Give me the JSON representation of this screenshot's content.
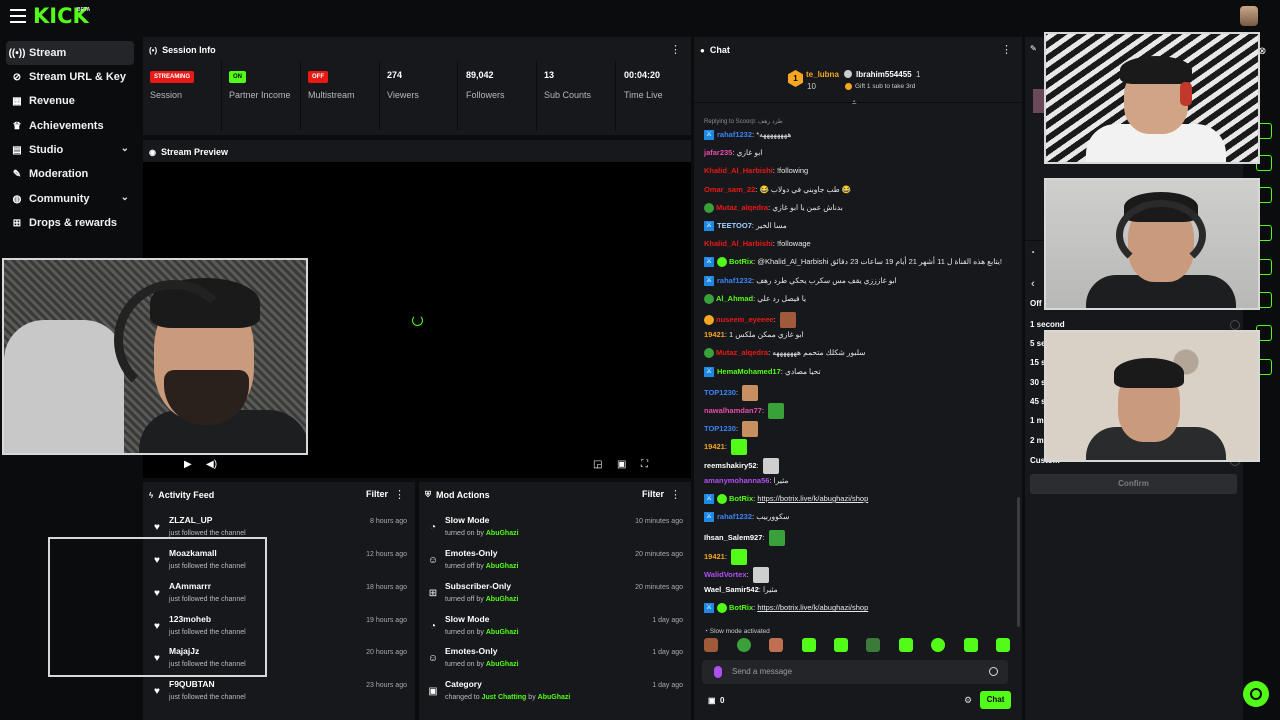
{
  "brand": {
    "logo": "KICK",
    "beta": "BETA"
  },
  "sidebar": {
    "items": [
      {
        "label": "Stream",
        "icon": "broadcast-icon",
        "active": true
      },
      {
        "label": "Stream URL & Key",
        "icon": "link-icon"
      },
      {
        "label": "Revenue",
        "icon": "revenue-icon"
      },
      {
        "label": "Achievements",
        "icon": "trophy-icon"
      },
      {
        "label": "Studio",
        "icon": "studio-icon",
        "expandable": true
      },
      {
        "label": "Moderation",
        "icon": "wrench-icon"
      },
      {
        "label": "Community",
        "icon": "community-icon",
        "expandable": true
      },
      {
        "label": "Drops & rewards",
        "icon": "gift-icon"
      }
    ]
  },
  "session": {
    "title": "Session Info",
    "stats": [
      {
        "value": "STREAMING",
        "label": "Session",
        "kind": "badge",
        "color": "#e91916"
      },
      {
        "value": "ON",
        "label": "Partner Income",
        "kind": "badge",
        "color": "#53fc18"
      },
      {
        "value": "OFF",
        "label": "Multistream",
        "kind": "badge",
        "color": "#e91916"
      },
      {
        "value": "274",
        "label": "Viewers"
      },
      {
        "value": "89,042",
        "label": "Followers"
      },
      {
        "value": "13",
        "label": "Sub Counts"
      },
      {
        "value": "00:04:20",
        "label": "Time Live"
      }
    ]
  },
  "preview": {
    "title": "Stream Preview"
  },
  "activity": {
    "title": "Activity Feed",
    "filter": "Filter",
    "rows": [
      {
        "name": "ZLZAL_UP",
        "sub": "just followed the channel",
        "time": "8 hours ago"
      },
      {
        "name": "Moazkamall",
        "sub": "just followed the channel",
        "time": "12 hours ago"
      },
      {
        "name": "AAmmarrr",
        "sub": "just followed the channel",
        "time": "18 hours ago"
      },
      {
        "name": "123moheb",
        "sub": "just followed the channel",
        "time": "19 hours ago"
      },
      {
        "name": "MajajJz",
        "sub": "just followed the channel",
        "time": "20 hours ago"
      },
      {
        "name": "F9QUBTAN",
        "sub": "just followed the channel",
        "time": "23 hours ago"
      }
    ]
  },
  "mod_actions": {
    "title": "Mod Actions",
    "filter": "Filter",
    "rows": [
      {
        "name": "Slow Mode",
        "action": "turned on by",
        "by": "AbuGhazi",
        "time": "10 minutes ago",
        "icon": "slow-mode-icon"
      },
      {
        "name": "Emotes-Only",
        "action": "turned off by",
        "by": "AbuGhazi",
        "time": "20 minutes ago",
        "icon": "emote-icon"
      },
      {
        "name": "Subscriber-Only",
        "action": "turned off by",
        "by": "AbuGhazi",
        "time": "20 minutes ago",
        "icon": "gift-icon"
      },
      {
        "name": "Slow Mode",
        "action": "turned on by",
        "by": "AbuGhazi",
        "time": "1 day ago",
        "icon": "slow-mode-icon"
      },
      {
        "name": "Emotes-Only",
        "action": "turned on by",
        "by": "AbuGhazi",
        "time": "1 day ago",
        "icon": "emote-icon"
      },
      {
        "name": "Category",
        "action": "changed to",
        "category": "Just Chatting",
        "by_prefix": "by",
        "by": "AbuGhazi",
        "time": "1 day ago",
        "icon": "category-icon"
      }
    ]
  },
  "chat": {
    "title": "Chat",
    "pinned": {
      "user1": "te_lubna",
      "user1_count": "10",
      "user1_rank": "1",
      "user2": "Ibrahim554455",
      "user2_count": "1",
      "gift_text": "Gift 1 sub to take 3rd"
    },
    "reply_to": "Replying to Scoorp: طرد رهف",
    "messages": [
      {
        "user": "rahaf1232",
        "text": "*ههههههههه",
        "color": "#3b82f6",
        "mod": true
      },
      {
        "user": "jafar235",
        "text": "ابو غازي",
        "color": "#e94cab"
      },
      {
        "user": "Khalid_Al_Harbishi",
        "text": "!following",
        "color": "#e91916"
      },
      {
        "user": "Omar_sam_22",
        "text": "😂 طب جاوبني في دولاب 😂",
        "color": "#e91916"
      },
      {
        "user": "Mutaz_alqedra",
        "text": "بدناش عمن يا ابو غازي",
        "color": "#e91916",
        "badge": "green"
      },
      {
        "user": "TEETOO7",
        "text": "مسا الخير",
        "color": "#9ad0ff",
        "mod": true
      },
      {
        "user": "Khalid_Al_Harbishi",
        "text": "!followage",
        "color": "#e91916"
      },
      {
        "user": "BotRix",
        "text": "@Khalid_Al_Harbishi يتابع هذه القناة ل 11 أشهر 21 أيام 19 ساعات 23 دقائق!",
        "color": "#53fc18",
        "mod": true,
        "verified": true
      },
      {
        "user": "rahaf1232",
        "text": "ابو غازززي يقف مس سكرب يحكي طرد رهف",
        "color": "#3b82f6",
        "mod": true
      },
      {
        "user": "Al_Ahmad",
        "text": "يا فيصل رد علي",
        "color": "#53fc18",
        "badge": "green"
      },
      {
        "user": "nuseem_eyeeee",
        "text": "",
        "color": "#e91916",
        "emote": "#a05a3a",
        "badge": "gold"
      },
      {
        "user": "19421",
        "text": "ابو غازي ممكن ملكس 1",
        "color": "#f5a623"
      },
      {
        "user": "Mutaz_alqedra",
        "text": "سلبور شكلك متحمم هههههههه",
        "color": "#e91916",
        "badge": "green"
      },
      {
        "user": "HemaMohamed17",
        "text": "تحيا مصادي",
        "color": "#53fc18",
        "mod": true
      },
      {
        "user": "TOP1230",
        "text": "",
        "color": "#3b82f6",
        "emote": "#c89060"
      },
      {
        "user": "nawalhamdan77",
        "text": "",
        "color": "#e94cab",
        "emote": "#3aa03a"
      },
      {
        "user": "TOP1230",
        "text": "",
        "color": "#3b82f6",
        "emote": "#c89060"
      },
      {
        "user": "19421",
        "text": "",
        "color": "#f5a623",
        "emote": "#53fc18"
      },
      {
        "user": "reemshakiry52",
        "text": "",
        "color": "#ffffff",
        "emote": "#cfcfcf"
      },
      {
        "user": "amanymohanna56",
        "text": "مثيرا",
        "color": "#b04ef0"
      },
      {
        "user": "BotRix",
        "text": "https://botrix.live/k/abughazi/shop",
        "color": "#53fc18",
        "mod": true,
        "verified": true,
        "link": true
      },
      {
        "user": "rahaf1232",
        "text": "سكووربيب",
        "color": "#3b82f6",
        "mod": true
      },
      {
        "user": "Ihsan_Salem927",
        "text": "",
        "color": "#ffffff",
        "emote": "#3aa03a"
      },
      {
        "user": "19421",
        "text": "",
        "color": "#f5a623",
        "emote": "#53fc18"
      },
      {
        "user": "WalidVortex",
        "text": "",
        "color": "#b04ef0",
        "emote": "#cfcfcf"
      },
      {
        "user": "Wael_Samir542",
        "text": "مثيرا",
        "color": "#ffffff"
      },
      {
        "user": "BotRix",
        "text": "https://botrix.live/k/abughazi/shop",
        "color": "#53fc18",
        "mod": true,
        "verified": true,
        "link": true
      }
    ],
    "slow_mode": "Slow mode activated",
    "input_placeholder": "Send a message",
    "points": "0",
    "send_label": "Chat"
  },
  "right_dock": {
    "options": [
      "Off",
      "1 second",
      "5 se",
      "15 s",
      "30 s",
      "45 s",
      "1 mi",
      "2 m",
      "Custom"
    ],
    "confirm": "Confirm"
  },
  "colors": {
    "accent": "#53fc18",
    "live": "#e91916",
    "panel": "#17181b",
    "bg": "#0b0c0e"
  }
}
